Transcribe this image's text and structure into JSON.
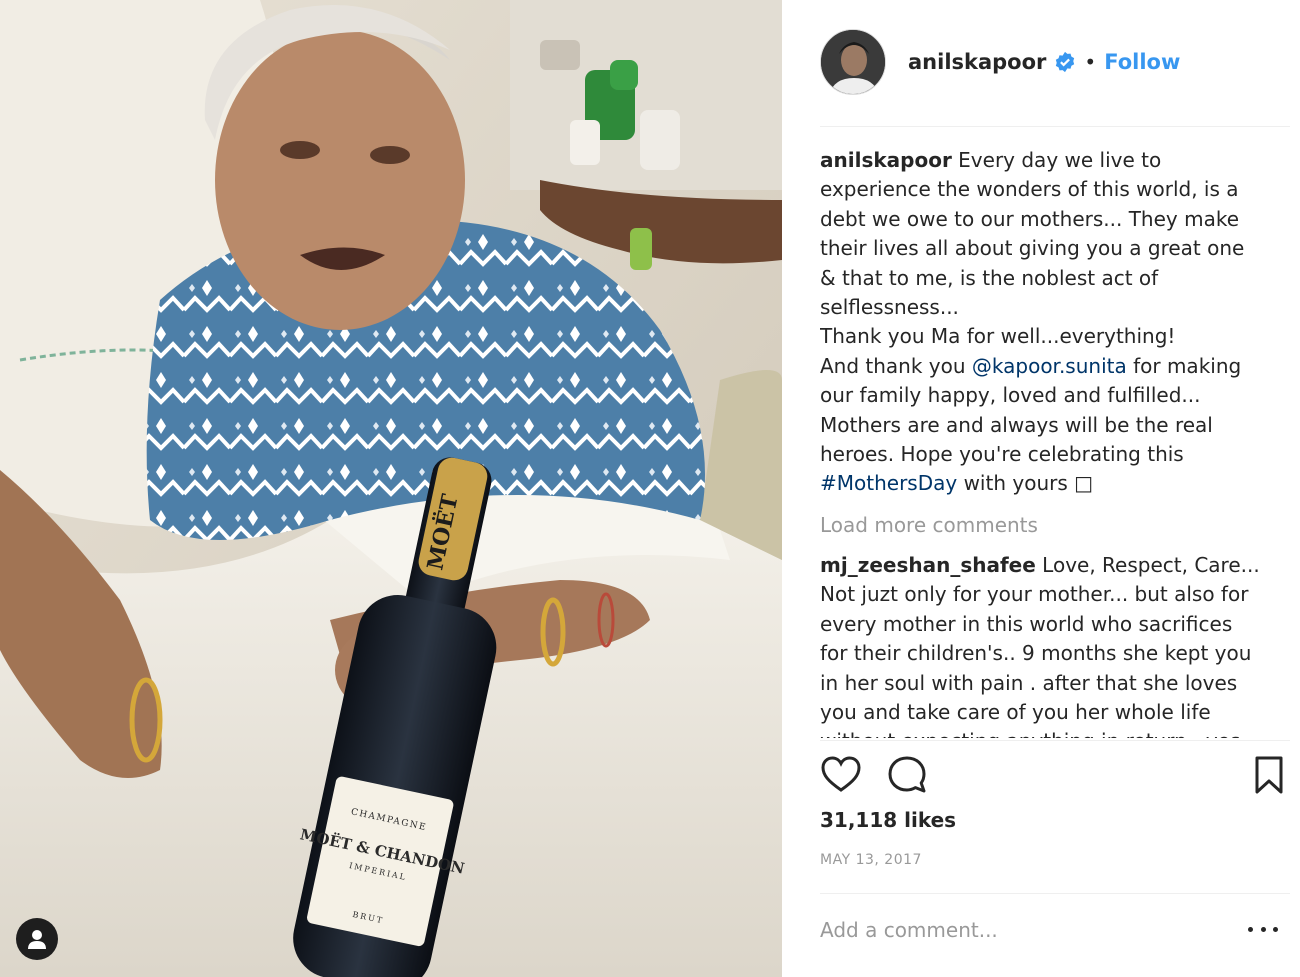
{
  "post": {
    "username": "anilskapoor",
    "follow_label": "Follow",
    "dot": "•",
    "caption": {
      "username": "anilskapoor",
      "text_1": " Every day we live to experience the wonders of this world, is a debt we owe to our mothers... They make their lives all about giving you a great one & that to me, is the noblest act of selflessness...",
      "text_2": "Thank you Ma for well...everything!",
      "text_3_before": "And thank you ",
      "mention": "@kapoor.sunita",
      "text_3_after": " for making our family happy, loved and fulfilled... Mothers are and always will be the real heroes. Hope you're celebrating this ",
      "hashtag": "#MothersDay",
      "text_end": " with yours □"
    },
    "load_more": "Load more comments",
    "comments": [
      {
        "username": "mj_zeeshan_shafee",
        "text": " Love, Respect, Care... Not juzt only for your mother... but also for every mother in this world who sacrifices for their children's.. 9 months she kept you in her soul with pain . after that she loves you and take care of you her whole life without expecting anything in return.. yes that's our mother and her whole life"
      }
    ],
    "likes": "31,118 likes",
    "date": "MAY 13, 2017",
    "add_comment_placeholder": "Add a comment..."
  },
  "photo": {
    "bottle_label_top": "CHAMPAGNE",
    "bottle_label_brand": "MOËT & CHANDON",
    "bottle_label_sub": "IMPERIAL",
    "bottle_label_bottom": "BRUT",
    "neck_text": "MOËT"
  },
  "colors": {
    "link": "#003569",
    "follow": "#3897f0",
    "muted": "#999999",
    "verified": "#3897f0"
  },
  "icons": [
    "heart-icon",
    "comment-icon",
    "bookmark-icon",
    "more-options-icon",
    "verified-badge-icon",
    "user-tag-icon"
  ]
}
